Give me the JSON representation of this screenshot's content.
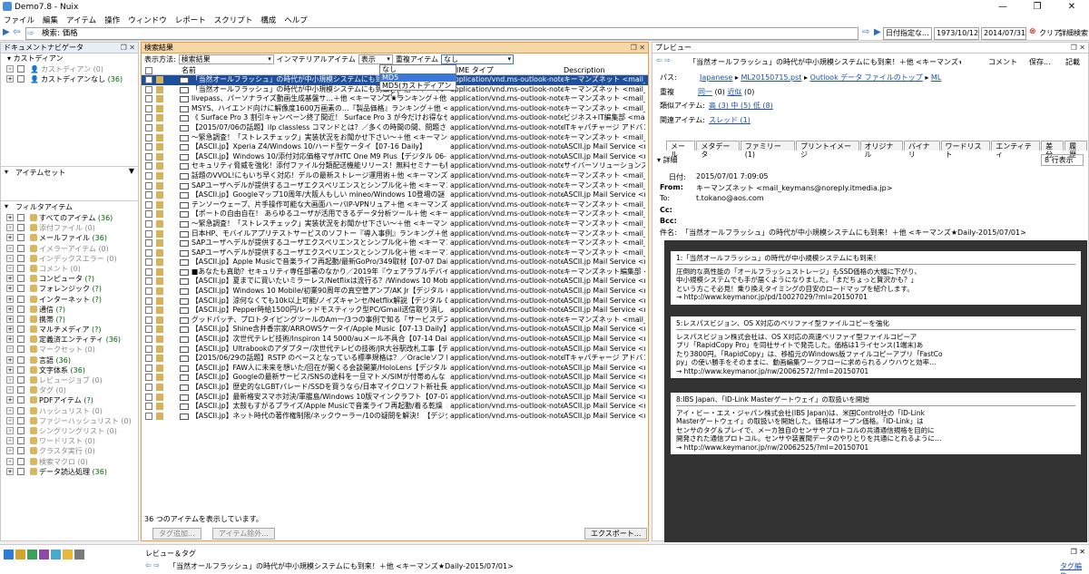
{
  "window": {
    "title": "Demo7.8 - Nuix",
    "controls": [
      "—",
      "❐",
      "✕"
    ]
  },
  "menu": [
    "ファイル",
    "編集",
    "アイテム",
    "操作",
    "ウィンドウ",
    "レポート",
    "スクリプト",
    "構成",
    "ヘルプ"
  ],
  "search": {
    "label": "検索: 価格",
    "date_filter": "日付指定な...",
    "date_from": "1973/10/12",
    "date_to": "2014/07/31",
    "clear": "クリア",
    "advanced": "詳細検索"
  },
  "left": {
    "doc_nav_title": "ドキュメントナビゲータ",
    "custodian_title": "カストディアン",
    "custodians": [
      {
        "label": "カストディアン",
        "count": "(0)",
        "grey": true
      },
      {
        "label": "カストディアンなし",
        "count": "(36)",
        "grey": false
      }
    ],
    "itemset_title": "アイテムセット",
    "filter_title": "フィルタアイテム",
    "filters": [
      {
        "label": "すべてのアイテム",
        "count": "(36)",
        "grey": false
      },
      {
        "label": "添付ファイル",
        "count": "(0)",
        "grey": true
      },
      {
        "label": "メールファイル",
        "count": "(36)",
        "grey": false
      },
      {
        "label": "イメラーアイテム",
        "count": "(0)",
        "grey": true
      },
      {
        "label": "インデックスエラー",
        "count": "(0)",
        "grey": true
      },
      {
        "label": "コメント",
        "count": "(0)",
        "grey": true
      },
      {
        "label": "コンピュータ",
        "count": "(?)",
        "grey": false
      },
      {
        "label": "フォレンジック",
        "count": "(?)",
        "grey": false
      },
      {
        "label": "インターネット",
        "count": "(?)",
        "grey": false
      },
      {
        "label": "通信",
        "count": "(?)",
        "grey": false
      },
      {
        "label": "携帯",
        "count": "(?)",
        "grey": false
      },
      {
        "label": "マルチメディア",
        "count": "(?)",
        "grey": false
      },
      {
        "label": "定義済エンティティ",
        "count": "(36)",
        "grey": false
      },
      {
        "label": "マークセット",
        "count": "(0)",
        "grey": true
      },
      {
        "label": "言語",
        "count": "(36)",
        "grey": false
      },
      {
        "label": "文字体系",
        "count": "(36)",
        "grey": false
      },
      {
        "label": "レビュージョブ",
        "count": "(0)",
        "grey": true
      },
      {
        "label": "タグ",
        "count": "(0)",
        "grey": true
      },
      {
        "label": "PDFアイテム",
        "count": "(?)",
        "grey": false
      },
      {
        "label": "ハッシュリスト",
        "count": "(0)",
        "grey": true
      },
      {
        "label": "ファジーハッシュリスト",
        "count": "(0)",
        "grey": true
      },
      {
        "label": "シングリングリスト",
        "count": "(0)",
        "grey": true
      },
      {
        "label": "ワードリスト",
        "count": "(0)",
        "grey": true
      },
      {
        "label": "クラスタ実行",
        "count": "(0)",
        "grey": true
      },
      {
        "label": "検索マクロ",
        "count": "(0)",
        "grey": true
      },
      {
        "label": "データ読込処理",
        "count": "(36)",
        "grey": false
      }
    ]
  },
  "results": {
    "title": "検索結果",
    "display_label": "表示方法:",
    "display_value": "検索結果",
    "immaterial_label": "インマテリアルアイテム",
    "immaterial_value": "表示",
    "dup_label": "重複アイテム",
    "dup_value": "なし",
    "dropdown_options": [
      "なし",
      "MD5",
      "MD5(カストディアンごと)"
    ],
    "columns": {
      "name": "名前",
      "mime": "MIME タイプ",
      "desc": "Description"
    },
    "rows": [
      {
        "name": "「当然オールフラッシュ」の時代が中小規模システムにも到来！＋他 <キーマンズ★Daily-2015/07/01>",
        "mime": "application/vnd.ms-outlook-note",
        "desc": "キーマンズネット <mail_keyman"
      },
      {
        "name": "「当然オールフラッシュ」の時代が中小規模システムにも到来！＋他 <キーマンズ★Daily-2015/07/",
        "mime": "application/vnd.ms-outlook-note",
        "desc": "キーマンズネット <mail_keyman"
      },
      {
        "name": "livepass、パーソナライズ動画生成基盤サ…＋他 <キーマンズ★ランキング＋他 <キーマンズ★Daily-2015/07/",
        "mime": "application/vnd.ms-outlook-note",
        "desc": "キーマンズネット <mail_keyman"
      },
      {
        "name": "MSYS、ハイエンド向けに解像度1600万画素の…『製品価格』ランキング＋他 <キーマンズ★D",
        "mime": "application/vnd.ms-outlook-note",
        "desc": "キーマンズネット <mail_keyman"
      },
      {
        "name": "《 Surface Pro 3 割引キャンペーン終了間近！ Surface Pro 3 が今だけお得なセット価格に",
        "mime": "application/vnd.ms-outlook-note",
        "desc": "ビジネス+IT編集部 <mail@m"
      },
      {
        "name": "【2015/07/06の話題】iIp classless コマンドとは？／多くの時間の間、問題さえすれば",
        "mime": "application/vnd.ms-outlook-note",
        "desc": "ITキャパチャージ アドバンス",
        "selected_row": false
      },
      {
        "name": "〜緊急調査！「ストレスチェック」実装状況をお聞かせ下さい〜＋他 <キーマンズ★Daily-2015/07",
        "mime": "application/vnd.ms-outlook-note",
        "desc": "キーマンズネット <mail_keyman"
      },
      {
        "name": "【ASCII.jp】Xperia Z4/Windows 10/ハード型ケータイ【07-16 Daily】",
        "mime": "application/vnd.ms-outlook-note",
        "desc": "ASCII.jp Mail Service <mail"
      },
      {
        "name": "【ASCII.jp】Windows 10/添付対応価格マザ/HTC One M9 Plus【デジタル 06-15】",
        "mime": "application/vnd.ms-outlook-note",
        "desc": "ASCII.jp Mail Service <mail"
      },
      {
        "name": "セキュリティ脅威を強化！添付ファイル分類配送機能リリース！無料セミナーも特別受付中！ -CS",
        "mime": "application/vnd.ms-outlook-note",
        "desc": "サイバーソリューションズ <mail"
      },
      {
        "name": "話題のVVOL!にもいち早く対応！デルの最新ストレージ運用術＋他 <キーマンズ★Daily-201",
        "mime": "application/vnd.ms-outlook-note",
        "desc": "キーマンズネット <mail_keyman"
      },
      {
        "name": "SAPユーザへデルが提供するユーザエクスペリエンスとシンプル化＋他 <キーマンズ★Daily-2",
        "mime": "application/vnd.ms-outlook-note",
        "desc": "キーマンズネット <mail_keyman"
      },
      {
        "name": "【ASCII.jp】Googleマップ10周年/大阪人もしい mineo/Windows 10登場の謎【07-15 Daily】",
        "mime": "application/vnd.ms-outlook-note",
        "desc": "ASCII.jp Mail Service <mail"
      },
      {
        "name": "テンソーウェーブ、片手操作可能な大画面ハーバIP-VPNリュア＋他 <キーマンズ★Daily-2015",
        "mime": "application/vnd.ms-outlook-note",
        "desc": "キーマンズネット <mail_keyman"
      },
      {
        "name": "【ポートの自由自在！ あらゆるユーザが活用できるデータ分析ツール＋他 <キーマンズ★Daily",
        "mime": "application/vnd.ms-outlook-note",
        "desc": "キーマンズネット <mail_keyman"
      },
      {
        "name": "〜緊急調査！「ストレスチェック」実装状況をお聞かせ下さい〜＋他 <キーマンズ★Daily-2015/07",
        "mime": "application/vnd.ms-outlook-note",
        "desc": "キーマンズネット <mail_keyman"
      },
      {
        "name": "日本HP、モバイルアプリテストサービスのソフトー『導入事例』ランキング＋他 <キーマンズ★Daily-20",
        "mime": "application/vnd.ms-outlook-note",
        "desc": "キーマンズネット <mail_keyman"
      },
      {
        "name": "SAPユーザへデルが提供するユーザエクスペリエンスとシンプル化＋他 <キーマンズ★Daily-2",
        "mime": "application/vnd.ms-outlook-note",
        "desc": "キーマンズネット <mail_keyman"
      },
      {
        "name": "SAPユーザへデルが提供するユーザエクスペリエンスとシンプル化＋他 <キーマンズ★Daily-2",
        "mime": "application/vnd.ms-outlook-note",
        "desc": "キーマンズネット <mail_keyman"
      },
      {
        "name": "【ASCII.jp】Apple Musicで音楽ライフ再起動/最新GoPro/349取材【07-07 Daily】",
        "mime": "application/vnd.ms-outlook-note",
        "desc": "ASCII.jp Mail Service <mail"
      },
      {
        "name": "■あなたも真助？セキュリティ専任部署のなかり／2019年『ウェアラブルデバイス進化』のロードマ",
        "mime": "application/vnd.ms-outlook-note",
        "desc": "キーマンズネット編集部 <mail"
      },
      {
        "name": "【ASCII.jp】夏までに買いたいミラーレス/Netflixは流行る？/Windows 10 Mobile【06-24 Daily】",
        "mime": "application/vnd.ms-outlook-note",
        "desc": "ASCII.jp Mail Service <mail"
      },
      {
        "name": "【ASCII.jp】Windows 10 Mobile/初業90周年の真空管アンプ/AK Jr【デジタル 06-22】",
        "mime": "application/vnd.ms-outlook-note",
        "desc": "ASCII.jp Mail Service <mail"
      },
      {
        "name": "【ASCII.jp】涼何なくても10k以上可能/ノイズキャンセ/Netflix解説【デジタル 06-26】",
        "mime": "application/vnd.ms-outlook-note",
        "desc": "ASCII.jp Mail Service <mail"
      },
      {
        "name": "【ASCII.jp】Pepper時給1500円/レッドモスティック型PC/Gmail送信取り消し【06-25 Daily】",
        "mime": "application/vnd.ms-outlook-note",
        "desc": "ASCII.jp Mail Service <mail"
      },
      {
        "name": "グッドパッチ、プロトタイピングツールのAm一/3つの事例で知る「サービスデスクツール」＋他 <キー",
        "mime": "application/vnd.ms-outlook-note",
        "desc": "キーマンズネット <mail_keyman"
      },
      {
        "name": "【ASCII.jp】Shine含井香宗家/ARROWSケータイ/Apple Music【07-13 Daily】",
        "mime": "application/vnd.ms-outlook-note",
        "desc": "ASCII.jp Mail Service <mail"
      },
      {
        "name": "【ASCII.jp】次世代テレビ技術/Inspiron 14 5000/auメール不具合【07-14 Daily】",
        "mime": "application/vnd.ms-outlook-note",
        "desc": "ASCII.jp Mail Service <mail"
      },
      {
        "name": "【ASCII.jp】Ultrabookのアダプター/次世代テレビの技術/JR大谷駅改札工事【デジタル 07-15】",
        "mime": "application/vnd.ms-outlook-note",
        "desc": "ASCII.jp Mail Service <mail"
      },
      {
        "name": "【2015/06/29の話題】RSTP のベースとなっている標準規格は？／Oracleソフトウェアの配置先を",
        "mime": "application/vnd.ms-outlook-note",
        "desc": "ITキャパチャージ アドバンス"
      },
      {
        "name": "【ASCII.jp】FAW人に未来を想いた/回在が開くる会談開業/HoloLens【デジタル 06-30】",
        "mime": "application/vnd.ms-outlook-note",
        "desc": "ASCII.jp Mail Service <mail"
      },
      {
        "name": "【ASCII.jp】Googleの最新サービス/SNSの途料を一旦マトメ/SIMが付帯めんな【07-01 Daily】",
        "mime": "application/vnd.ms-outlook-note",
        "desc": "ASCII.jp Mail Service <mail"
      },
      {
        "name": "【ASCII.jp】歴史的なLGBTパレード/SSDを買うなら/日本マイクロソフト新社長【07-03 Daily】",
        "mime": "application/vnd.ms-outlook-note",
        "desc": "ASCII.jp Mail Service <mail"
      },
      {
        "name": "【ASCII.jp】最新格安スマホ対決/軍艦島/Windows 10版マインクラフト【07-07 Daily】",
        "mime": "application/vnd.ms-outlook-note",
        "desc": "ASCII.jp Mail Service <mail"
      },
      {
        "name": "【ASCII.jp】太鼓もすがるプライズ/Apple Musicで音楽ライフ再起動/着る乾燥【デジタル 07-09】",
        "mime": "application/vnd.ms-outlook-note",
        "desc": "ASCII.jp Mail Service <mail"
      },
      {
        "name": "【ASCII.jp】ネット時代の著作権制限/ネックウーラー/10の疑問を解決！【デジタル 07-09】",
        "mime": "application/vnd.ms-outlook-note",
        "desc": "ASCII.jp Mail Service <mail"
      }
    ],
    "status": "36 つのアイテムを表示しています。",
    "btn_tag": "タグ追加...",
    "btn_exclude": "アイテム除外...",
    "btn_export": "エクスポート..."
  },
  "preview": {
    "title": "プレビュー",
    "subject": "「当然オールフラッシュ」の時代が中小規模システムにも到来！＋他 <キーマンズ★Daily-2015/07/01>",
    "comment": "コメント",
    "save": "保存...",
    "memo": "記載",
    "path_label": "パス:",
    "path": [
      "Japanese",
      "ML20150715.pst",
      "Outlook データ ファイルのトップ",
      "ML"
    ],
    "dup_label": "重複",
    "dup_links": [
      "同一",
      "(0)",
      "近似",
      "(0)"
    ],
    "similar_label": "類似アイテム:",
    "similar": "高 (3)  中 (5)  低 (8)",
    "related_label": "関連アイテム:",
    "related": "スレッド (1)",
    "tabs": [
      "メール",
      "メタデータ",
      "ファミリー (1)",
      "プリントイメージ",
      "オリジナル",
      "バイナリ",
      "ワードリスト",
      "エンティティ",
      "差分",
      "履歴"
    ],
    "detail": "詳細",
    "lines_select": "8 行表示",
    "date_label": "日付:",
    "date": "2015/07/01 7:09:05",
    "from_label": "From:",
    "from": "キーマンズネット <mail_keymans@noreply.itmedia.jp>",
    "to_label": "To:",
    "to": "t.tokano@aos.com",
    "cc_label": "Cc:",
    "bcc_label": "Bcc:",
    "subj_label": "件名:",
    "cards": [
      {
        "head": "1:「当然オールフラッシュ」の時代が中小規模システムにも到来！",
        "lines": [
          "圧倒的な高性能の「オールフラッシュストレージ」もSSD価格の大幅に下がり、",
          "中小規模システムでも手が届くようになりました。「まだちょっと贅沢かも？」",
          "という方こそ必見！乗り換えタイミングの目安のロードマップを紹介します。",
          "→ http://www.keymanor.jp/pd/10027029/?ml=20150701"
        ]
      },
      {
        "head": "5:レスパスビジョン、OS X対応のベリファイ型ファイルコピーを強化",
        "lines": [
          "レスパスビジョン株式会社は、OS X対応の高速ベリファイ型ファイルコピーア",
          "プリ「RapidCopy Pro」を同社サイトで発売した。価格は1ライセンス(1端末)あ",
          "たり3800円。「RapidCopy」は、移植元のWindows版ファイルコピーアプリ「FastCo",
          "py」の使い勝手をそのままに、動画編集ワークフローに求められるノウハウと効率…",
          "→ http://www.keymanor.jp/nw/20062572/?ml=20150701"
        ]
      },
      {
        "head": "8:IBS Japan、「ID-Link Masterゲートウェイ」の取扱いを開始",
        "lines": [
          "アイ・ビー・エス・ジャパン株式会社(IBS Japan)は、米国Control社の「ID-Link",
          "Masterゲートウェイ」の取扱いを開始した。価格はオープン価格。「ID-Link」は",
          "センサのタグ＆プレイで、メーカ独自のセンサやプロトコルの共通通信規格を目的に",
          "開発された通信プロトコル。センサや装置間データのやりとりを共通にとれるように…",
          "→ http://www.keymanor.jp/nw/20062525/?ml=20150701"
        ]
      }
    ]
  },
  "bottom": {
    "review_title": "レビュー＆タグ",
    "subject": "「当然オールフラッシュ」の時代が中小規模システムにも到来！＋他 <キーマンズ★Daily-2015/07/01>",
    "tags_label": "タグ編集..."
  },
  "colors": {
    "accent": "#e89c3a",
    "selection": "#1e4f9c",
    "link": "#1a4fb4"
  }
}
